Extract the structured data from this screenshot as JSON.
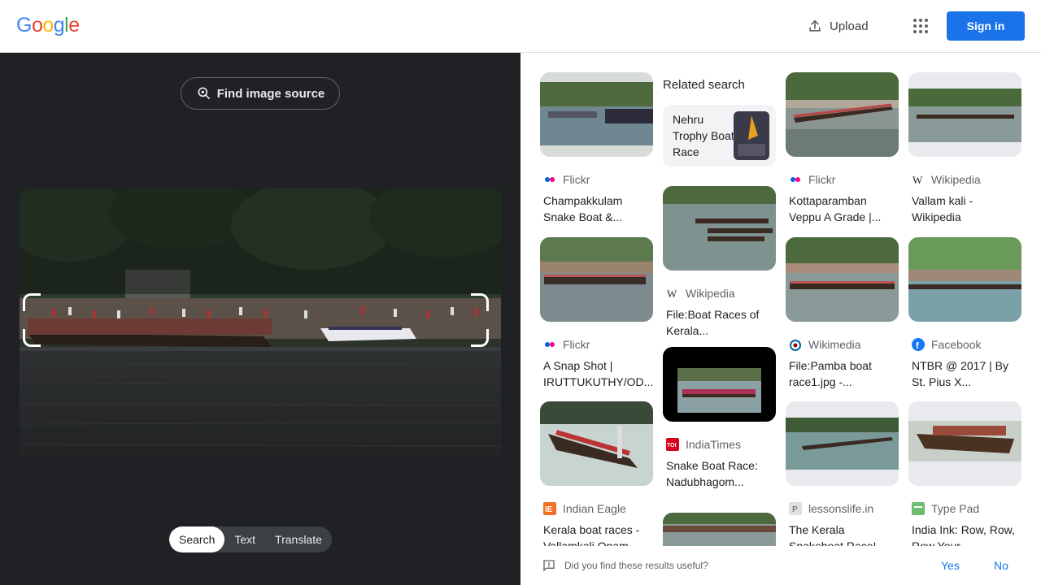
{
  "header": {
    "logo_letters": [
      {
        "ch": "G",
        "color": "#4285F4"
      },
      {
        "ch": "o",
        "color": "#EA4335"
      },
      {
        "ch": "o",
        "color": "#FBBC05"
      },
      {
        "ch": "g",
        "color": "#4285F4"
      },
      {
        "ch": "l",
        "color": "#34A853"
      },
      {
        "ch": "e",
        "color": "#EA4335"
      }
    ],
    "upload_label": "Upload",
    "apps_icon": "apps-grid-icon",
    "signin_label": "Sign in"
  },
  "left": {
    "find_source_label": "Find image source",
    "modes": [
      "Search",
      "Text",
      "Translate"
    ],
    "active_mode": "Search"
  },
  "right": {
    "related_heading": "Related search",
    "related_item": "Nehru Trophy Boat Race",
    "results": [
      {
        "source": "Flickr",
        "title": "Champakkulam Snake Boat &...",
        "icon": "flickr-icon"
      },
      {
        "source": "Flickr",
        "title": "Kottaparamban Veppu A Grade |...",
        "icon": "flickr-icon"
      },
      {
        "source": "Wikipedia",
        "title": "Vallam kali - Wikipedia",
        "icon": "wikipedia-icon"
      },
      {
        "source": "Wikipedia",
        "title": "File:Boat Races of Kerala...",
        "icon": "wikipedia-icon"
      },
      {
        "source": "Flickr",
        "title": "A Snap Shot | IRUTTUKUTHY/OD...",
        "icon": "flickr-icon"
      },
      {
        "source": "Wikimedia",
        "title": "File:Pamba boat race1.jpg -...",
        "icon": "wikimedia-icon"
      },
      {
        "source": "Facebook",
        "title": "NTBR @ 2017 | By St. Pius X...",
        "icon": "facebook-icon"
      },
      {
        "source": "IndiaTimes",
        "title": "Snake Boat Race: Nadubhagom...",
        "icon": "indiatimes-icon"
      },
      {
        "source": "Indian Eagle",
        "title": "Kerala boat races - Vallamkali Onam...",
        "icon": "indianeagle-icon"
      },
      {
        "source": "lessonslife.in",
        "title": "The Kerala Snakeboat Race! ...",
        "icon": "lessonslife-icon"
      },
      {
        "source": "Type Pad",
        "title": "India Ink: Row, Row, Row Your...",
        "icon": "typepad-icon"
      }
    ]
  },
  "feedback": {
    "question": "Did you find these results useful?",
    "yes": "Yes",
    "no": "No"
  }
}
